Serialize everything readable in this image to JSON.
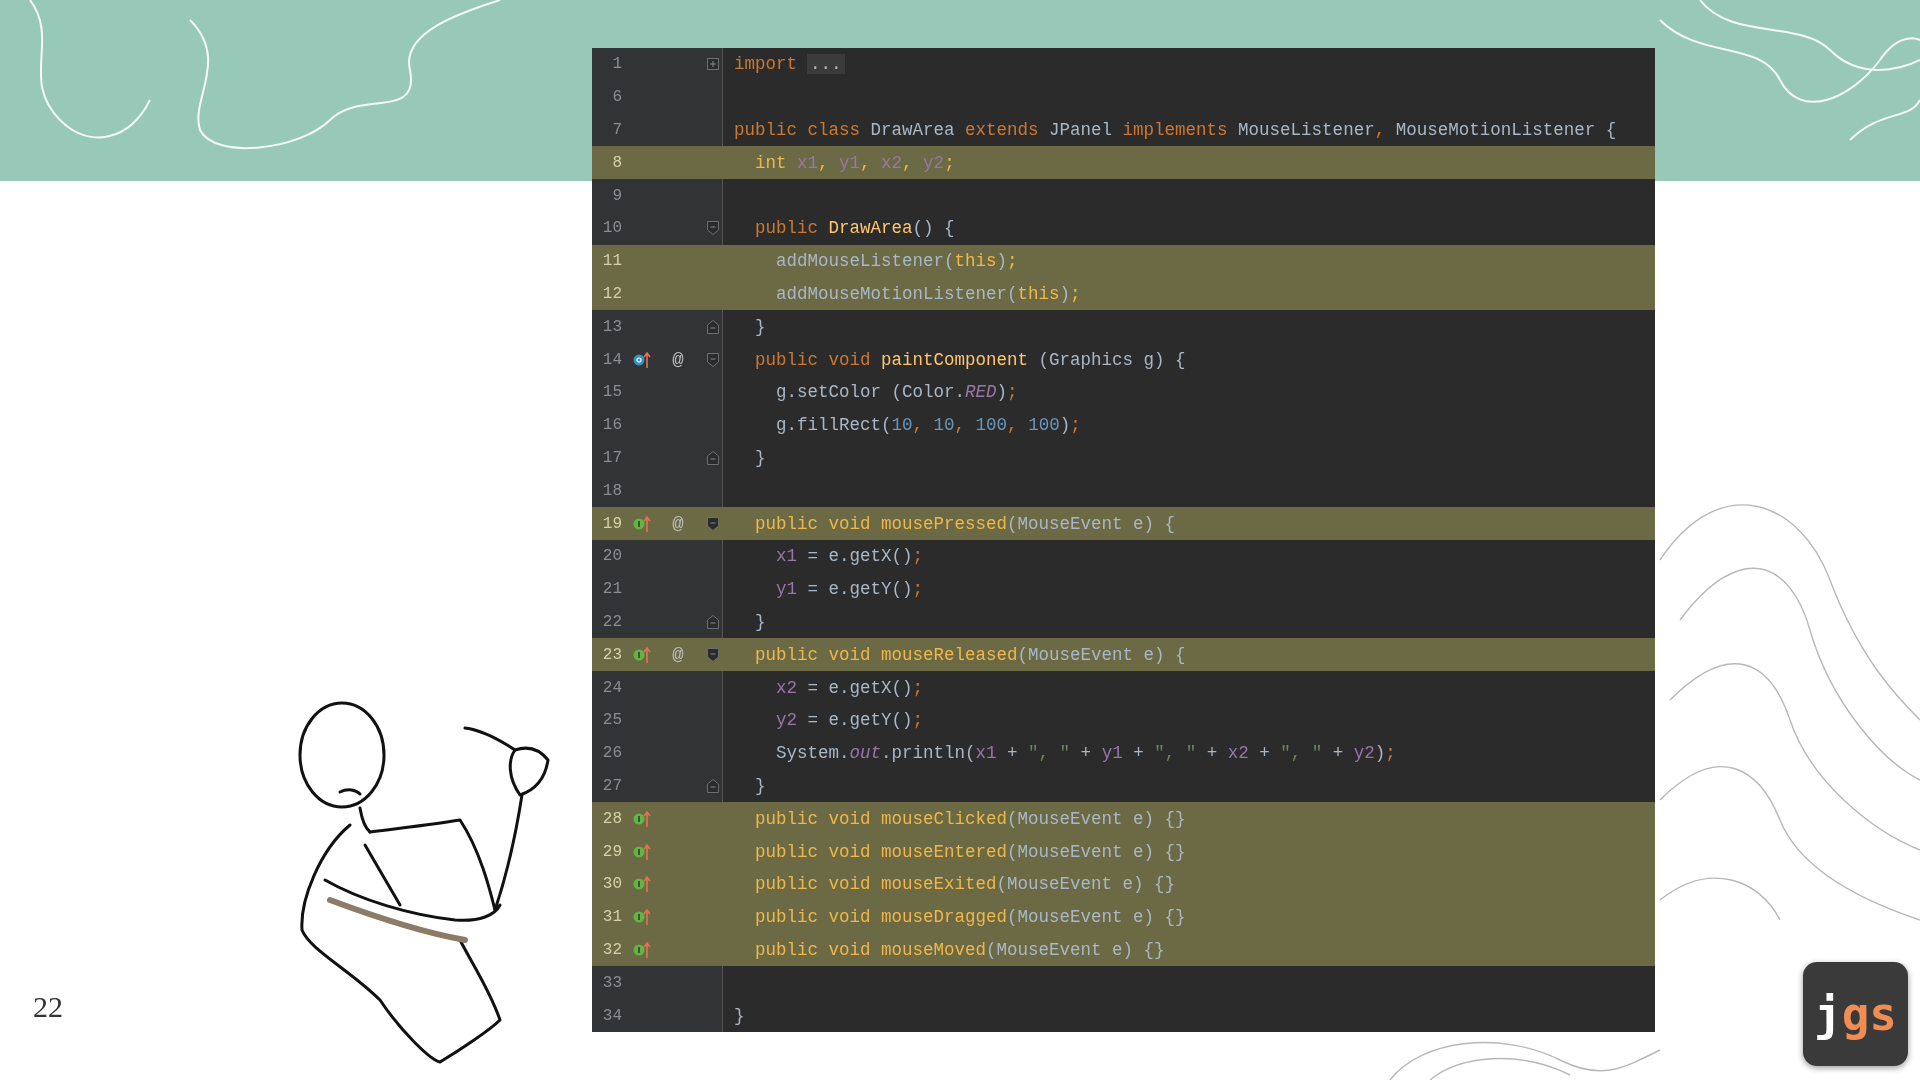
{
  "slide_number": "22",
  "logo": {
    "first": "j",
    "rest": "gs"
  },
  "editor": {
    "lines": [
      {
        "number": "1",
        "highlighted": false,
        "gutter": [
          {
            "kind": "fold_collapsed"
          }
        ],
        "tokens": [
          {
            "kind": "kw",
            "text": "import"
          },
          {
            "kind": "folded",
            "text": "..."
          }
        ]
      },
      {
        "number": "6",
        "highlighted": false
      },
      {
        "number": "7",
        "highlighted": false,
        "tokens": [
          {
            "kind": "kw",
            "text": "public class "
          },
          {
            "kind": "plain",
            "text": "DrawArea "
          },
          {
            "kind": "kw",
            "text": "extends "
          },
          {
            "kind": "plain",
            "text": "JPanel "
          },
          {
            "kind": "kw",
            "text": "implements "
          },
          {
            "kind": "plain",
            "text": "MouseListener"
          },
          {
            "kind": "punct",
            "text": ", "
          },
          {
            "kind": "plain",
            "text": "MouseMotionListener {"
          }
        ]
      },
      {
        "number": "8",
        "highlighted": true,
        "tokens": [
          {
            "kind": "kw",
            "text": "  int "
          },
          {
            "kind": "field",
            "text": "x1"
          },
          {
            "kind": "punct",
            "text": ", "
          },
          {
            "kind": "field",
            "text": "y1"
          },
          {
            "kind": "punct",
            "text": ", "
          },
          {
            "kind": "field",
            "text": "x2"
          },
          {
            "kind": "punct",
            "text": ", "
          },
          {
            "kind": "field",
            "text": "y2"
          },
          {
            "kind": "punct",
            "text": ";"
          }
        ]
      },
      {
        "number": "9",
        "highlighted": false
      },
      {
        "number": "10",
        "highlighted": false,
        "gutter": [
          {
            "kind": "fold_start"
          }
        ],
        "tokens": [
          {
            "kind": "kw",
            "text": "  public "
          },
          {
            "kind": "decl",
            "text": "DrawArea"
          },
          {
            "kind": "plain",
            "text": "() {"
          }
        ]
      },
      {
        "number": "11",
        "highlighted": true,
        "tokens": [
          {
            "kind": "plain",
            "text": "    addMouseListener("
          },
          {
            "kind": "kw",
            "text": "this"
          },
          {
            "kind": "plain",
            "text": ")"
          },
          {
            "kind": "punct",
            "text": ";"
          }
        ]
      },
      {
        "number": "12",
        "highlighted": true,
        "tokens": [
          {
            "kind": "plain",
            "text": "    addMouseMotionListener("
          },
          {
            "kind": "kw",
            "text": "this"
          },
          {
            "kind": "plain",
            "text": ")"
          },
          {
            "kind": "punct",
            "text": ";"
          }
        ]
      },
      {
        "number": "13",
        "highlighted": false,
        "gutter": [
          {
            "kind": "fold_end"
          }
        ],
        "tokens": [
          {
            "kind": "plain",
            "text": "  }"
          }
        ]
      },
      {
        "number": "14",
        "highlighted": false,
        "annotation": "@",
        "gutter": [
          {
            "kind": "overrides"
          },
          {
            "kind": "fold_start"
          }
        ],
        "tokens": [
          {
            "kind": "kw",
            "text": "  public void "
          },
          {
            "kind": "decl",
            "text": "paintComponent"
          },
          {
            "kind": "plain",
            "text": " (Graphics g) {"
          }
        ]
      },
      {
        "number": "15",
        "highlighted": false,
        "tokens": [
          {
            "kind": "plain",
            "text": "    g.setColor (Color."
          },
          {
            "kind": "const",
            "text": "RED"
          },
          {
            "kind": "plain",
            "text": ")"
          },
          {
            "kind": "punct",
            "text": ";"
          }
        ]
      },
      {
        "number": "16",
        "highlighted": false,
        "tokens": [
          {
            "kind": "plain",
            "text": "    g.fillRect("
          },
          {
            "kind": "num",
            "text": "10"
          },
          {
            "kind": "punct",
            "text": ", "
          },
          {
            "kind": "num",
            "text": "10"
          },
          {
            "kind": "punct",
            "text": ", "
          },
          {
            "kind": "num",
            "text": "100"
          },
          {
            "kind": "punct",
            "text": ", "
          },
          {
            "kind": "num",
            "text": "100"
          },
          {
            "kind": "plain",
            "text": ")"
          },
          {
            "kind": "punct",
            "text": ";"
          }
        ]
      },
      {
        "number": "17",
        "highlighted": false,
        "gutter": [
          {
            "kind": "fold_end"
          }
        ],
        "tokens": [
          {
            "kind": "plain",
            "text": "  }"
          }
        ]
      },
      {
        "number": "18",
        "highlighted": false
      },
      {
        "number": "19",
        "highlighted": true,
        "annotation": "@",
        "gutter": [
          {
            "kind": "implements"
          },
          {
            "kind": "fold_start"
          }
        ],
        "tokens": [
          {
            "kind": "kw",
            "text": "  public void "
          },
          {
            "kind": "decl",
            "text": "mousePressed"
          },
          {
            "kind": "plain",
            "text": "(MouseEvent e) {"
          }
        ]
      },
      {
        "number": "20",
        "highlighted": false,
        "tokens": [
          {
            "kind": "field",
            "text": "    x1"
          },
          {
            "kind": "plain",
            "text": " = e.getX()"
          },
          {
            "kind": "punct",
            "text": ";"
          }
        ]
      },
      {
        "number": "21",
        "highlighted": false,
        "tokens": [
          {
            "kind": "field",
            "text": "    y1"
          },
          {
            "kind": "plain",
            "text": " = e.getY()"
          },
          {
            "kind": "punct",
            "text": ";"
          }
        ]
      },
      {
        "number": "22",
        "highlighted": false,
        "gutter": [
          {
            "kind": "fold_end"
          }
        ],
        "tokens": [
          {
            "kind": "plain",
            "text": "  }"
          }
        ]
      },
      {
        "number": "23",
        "highlighted": true,
        "annotation": "@",
        "gutter": [
          {
            "kind": "implements"
          },
          {
            "kind": "fold_start"
          }
        ],
        "tokens": [
          {
            "kind": "kw",
            "text": "  public void "
          },
          {
            "kind": "decl",
            "text": "mouseReleased"
          },
          {
            "kind": "plain",
            "text": "(MouseEvent e) {"
          }
        ]
      },
      {
        "number": "24",
        "highlighted": false,
        "tokens": [
          {
            "kind": "field",
            "text": "    x2"
          },
          {
            "kind": "plain",
            "text": " = e.getX()"
          },
          {
            "kind": "punct",
            "text": ";"
          }
        ]
      },
      {
        "number": "25",
        "highlighted": false,
        "tokens": [
          {
            "kind": "field",
            "text": "    y2"
          },
          {
            "kind": "plain",
            "text": " = e.getY()"
          },
          {
            "kind": "punct",
            "text": ";"
          }
        ]
      },
      {
        "number": "26",
        "highlighted": false,
        "tokens": [
          {
            "kind": "plain",
            "text": "    System."
          },
          {
            "kind": "const",
            "text": "out"
          },
          {
            "kind": "plain",
            "text": ".println("
          },
          {
            "kind": "field",
            "text": "x1"
          },
          {
            "kind": "plain",
            "text": " + "
          },
          {
            "kind": "str",
            "text": "\", \""
          },
          {
            "kind": "plain",
            "text": " + "
          },
          {
            "kind": "field",
            "text": "y1"
          },
          {
            "kind": "plain",
            "text": " + "
          },
          {
            "kind": "str",
            "text": "\", \""
          },
          {
            "kind": "plain",
            "text": " + "
          },
          {
            "kind": "field",
            "text": "x2"
          },
          {
            "kind": "plain",
            "text": " + "
          },
          {
            "kind": "str",
            "text": "\", \""
          },
          {
            "kind": "plain",
            "text": " + "
          },
          {
            "kind": "field",
            "text": "y2"
          },
          {
            "kind": "plain",
            "text": ")"
          },
          {
            "kind": "punct",
            "text": ";"
          }
        ]
      },
      {
        "number": "27",
        "highlighted": false,
        "gutter": [
          {
            "kind": "fold_end"
          }
        ],
        "tokens": [
          {
            "kind": "plain",
            "text": "  }"
          }
        ]
      },
      {
        "number": "28",
        "highlighted": true,
        "gutter": [
          {
            "kind": "implements"
          }
        ],
        "tokens": [
          {
            "kind": "kw",
            "text": "  public void "
          },
          {
            "kind": "decl",
            "text": "mouseClicked"
          },
          {
            "kind": "plain",
            "text": "(MouseEvent e) {}"
          }
        ]
      },
      {
        "number": "29",
        "highlighted": true,
        "gutter": [
          {
            "kind": "implements"
          }
        ],
        "tokens": [
          {
            "kind": "kw",
            "text": "  public void "
          },
          {
            "kind": "decl",
            "text": "mouseEntered"
          },
          {
            "kind": "plain",
            "text": "(MouseEvent e) {}"
          }
        ]
      },
      {
        "number": "30",
        "highlighted": true,
        "gutter": [
          {
            "kind": "implements"
          }
        ],
        "tokens": [
          {
            "kind": "kw",
            "text": "  public void "
          },
          {
            "kind": "decl",
            "text": "mouseExited"
          },
          {
            "kind": "plain",
            "text": "(MouseEvent e) {}"
          }
        ]
      },
      {
        "number": "31",
        "highlighted": true,
        "gutter": [
          {
            "kind": "implements"
          }
        ],
        "tokens": [
          {
            "kind": "kw",
            "text": "  public void "
          },
          {
            "kind": "decl",
            "text": "mouseDragged"
          },
          {
            "kind": "plain",
            "text": "(MouseEvent e) {}"
          }
        ]
      },
      {
        "number": "32",
        "highlighted": true,
        "gutter": [
          {
            "kind": "implements"
          }
        ],
        "tokens": [
          {
            "kind": "kw",
            "text": "  public void "
          },
          {
            "kind": "decl",
            "text": "mouseMoved"
          },
          {
            "kind": "plain",
            "text": "(MouseEvent e) {}"
          }
        ]
      },
      {
        "number": "33",
        "highlighted": false
      },
      {
        "number": "34",
        "highlighted": false,
        "tokens": [
          {
            "kind": "plain",
            "text": "}"
          }
        ]
      }
    ]
  }
}
